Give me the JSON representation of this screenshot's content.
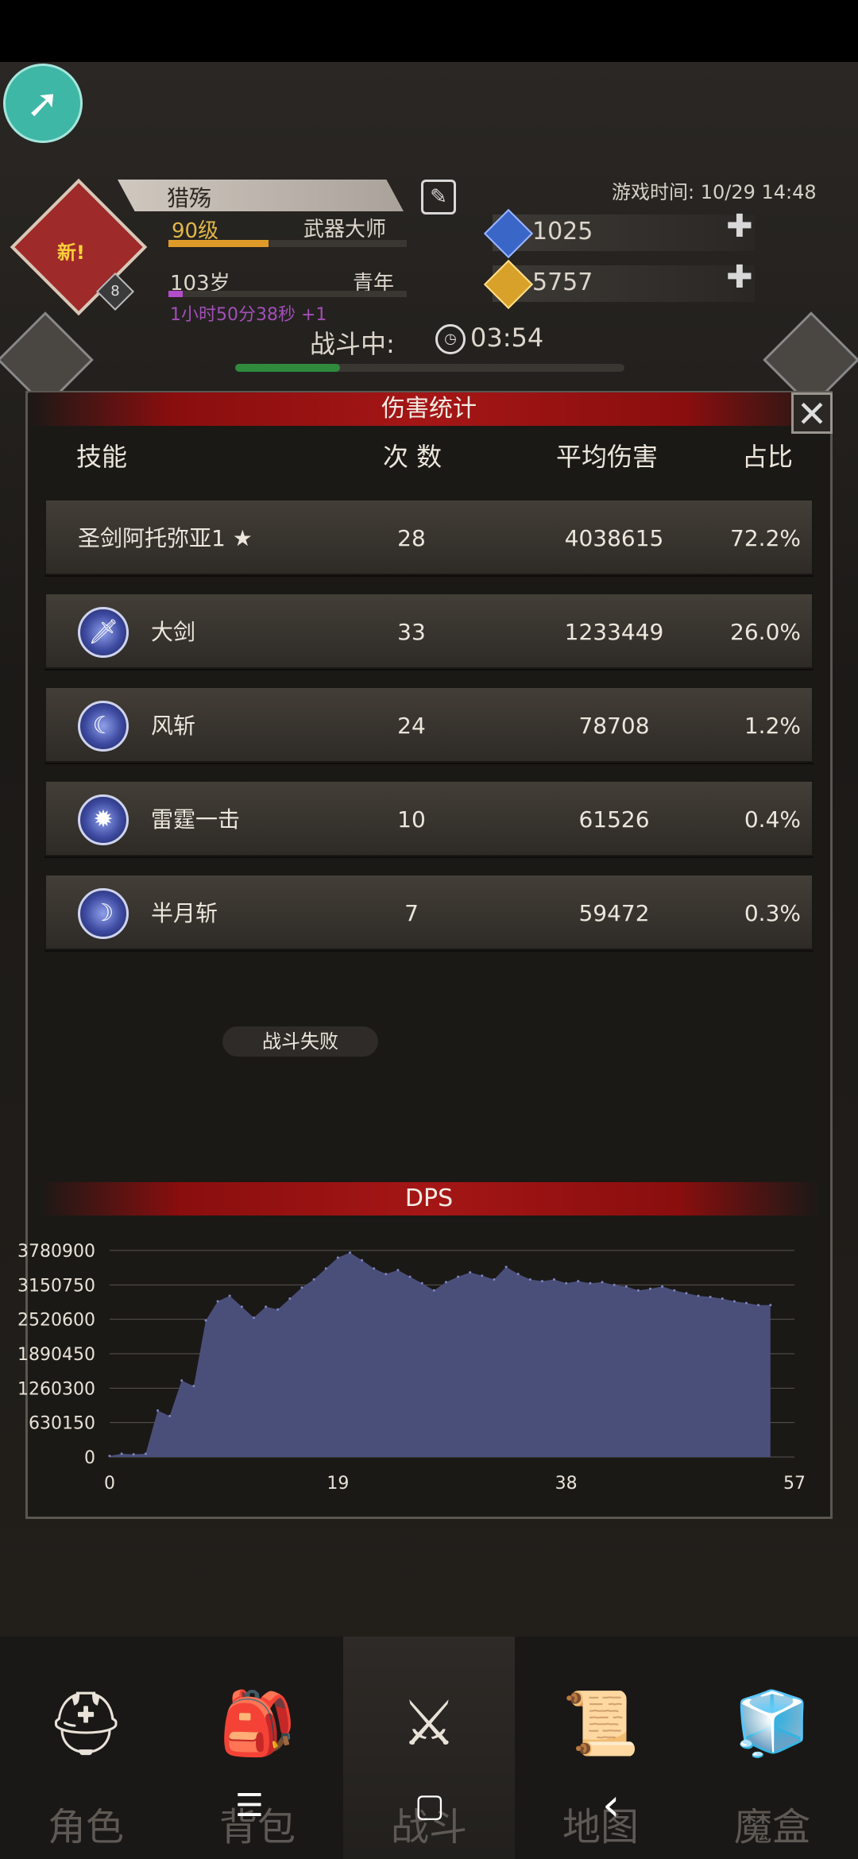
{
  "header": {
    "name": "猎殇",
    "level": "90级",
    "class": "武器大师",
    "age": "103岁",
    "age_stage": "青年",
    "age_timer": "1小时50分38秒 +1",
    "badge_new": "新!",
    "badge_number": "8",
    "game_time": "游戏时间: 10/29 14:48",
    "battle_label": "战斗中:",
    "battle_time": "03:54",
    "exp_progress": 0.42,
    "age_progress": 0.06,
    "battle_progress": 0.27
  },
  "currencies": [
    {
      "icon": "blue-gem-icon",
      "value": "1025",
      "color": "#3a66c8"
    },
    {
      "icon": "gold-gem-icon",
      "value": "5757",
      "color": "#d8a12a"
    }
  ],
  "damage_stats": {
    "title": "伤害统计",
    "columns": {
      "skill": "技能",
      "count": "次 数",
      "avg": "平均伤害",
      "pct": "占比"
    },
    "rows": [
      {
        "name": "圣剑阿托弥亚1 ★",
        "count": "28",
        "avg": "4038615",
        "pct": "72.2%",
        "icon": ""
      },
      {
        "name": "大剑",
        "count": "33",
        "avg": "1233449",
        "pct": "26.0%",
        "icon": "sword-skill-icon"
      },
      {
        "name": "风斩",
        "count": "24",
        "avg": "78708",
        "pct": "1.2%",
        "icon": "wind-slash-icon"
      },
      {
        "name": "雷霆一击",
        "count": "10",
        "avg": "61526",
        "pct": "0.4%",
        "icon": "thunder-strike-icon"
      },
      {
        "name": "半月斩",
        "count": "7",
        "avg": "59472",
        "pct": "0.3%",
        "icon": "half-moon-icon"
      }
    ],
    "status": "战斗失败"
  },
  "chart_data": {
    "type": "area",
    "title": "DPS",
    "xlabel": "",
    "ylabel": "",
    "x_ticks": [
      "0",
      "19",
      "38",
      "57"
    ],
    "y_ticks": [
      "3780900",
      "3150750",
      "2520600",
      "1890450",
      "1260300",
      "630150",
      "0"
    ],
    "xlim": [
      0,
      57
    ],
    "ylim": [
      0,
      3780900
    ],
    "grid": true,
    "fill_color": "#4a4f7a",
    "x": [
      0,
      1,
      2,
      3,
      4,
      5,
      6,
      7,
      8,
      9,
      10,
      11,
      12,
      13,
      14,
      15,
      16,
      17,
      18,
      19,
      20,
      21,
      22,
      23,
      24,
      25,
      26,
      27,
      28,
      29,
      30,
      31,
      32,
      33,
      34,
      35,
      36,
      37,
      38,
      39,
      40,
      41,
      42,
      43,
      44,
      45,
      46,
      47,
      48,
      49,
      50,
      51,
      52,
      53,
      54,
      55
    ],
    "y": [
      20000,
      60000,
      50000,
      60000,
      850000,
      750000,
      1400000,
      1300000,
      2500000,
      2850000,
      2950000,
      2750000,
      2550000,
      2750000,
      2700000,
      2900000,
      3100000,
      3250000,
      3450000,
      3650000,
      3740000,
      3600000,
      3450000,
      3350000,
      3420000,
      3300000,
      3180000,
      3050000,
      3200000,
      3300000,
      3380000,
      3320000,
      3250000,
      3480000,
      3350000,
      3250000,
      3220000,
      3250000,
      3180000,
      3220000,
      3180000,
      3200000,
      3150000,
      3120000,
      3050000,
      3080000,
      3120000,
      3050000,
      3000000,
      2950000,
      2930000,
      2900000,
      2850000,
      2820000,
      2780000,
      2780000
    ]
  },
  "nav": [
    {
      "label": "角色",
      "icon": "helmet-icon",
      "glyph": "⛑"
    },
    {
      "label": "背包",
      "icon": "backpack-icon",
      "glyph": "🎒"
    },
    {
      "label": "战斗",
      "icon": "sword-shield-icon",
      "glyph": "⚔"
    },
    {
      "label": "地图",
      "icon": "scroll-map-icon",
      "glyph": "📜"
    },
    {
      "label": "魔盒",
      "icon": "magic-box-icon",
      "glyph": "🧊"
    }
  ],
  "system_nav": {
    "menu": "☰",
    "home": "▢",
    "back": "‹"
  }
}
